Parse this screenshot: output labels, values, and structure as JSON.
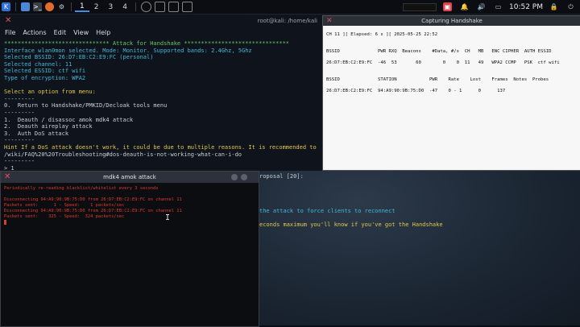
{
  "taskbar": {
    "workspaces": [
      "1",
      "2",
      "3",
      "4"
    ],
    "active_workspace": "1",
    "clock": "10:52 PM"
  },
  "main_terminal": {
    "title": "root@kali: /home/kali",
    "menu": [
      "File",
      "Actions",
      "Edit",
      "View",
      "Help"
    ],
    "lines": [
      {
        "text": "******************************* Attack for Handshake *******************************",
        "color": "c-green"
      },
      {
        "text": "Interface wlan0mon selected. Mode: Monitor. Supported bands: 2.4Ghz, 5Ghz",
        "color": "c-cyan"
      },
      {
        "text": "Selected BSSID: 26:D7:EB:C2:E9:FC (personal)",
        "color": "c-cyan"
      },
      {
        "text": "Selected channel: 11",
        "color": "c-cyan"
      },
      {
        "text": "Selected ESSID: ctf wifi",
        "color": "c-cyan"
      },
      {
        "text": "Type of encryption: WPA2",
        "color": "c-cyan"
      },
      {
        "text": "",
        "color": "c-grey"
      },
      {
        "text": "Select an option from menu:",
        "color": "c-yellow"
      },
      {
        "text": "---------",
        "color": "c-grey"
      },
      {
        "text": "0.  Return to Handshake/PMKID/Decloak tools menu",
        "color": "c-grey"
      },
      {
        "text": "---------",
        "color": "c-grey"
      },
      {
        "text": "1.  Deauth / disassoc amok mdk4 attack",
        "color": "c-grey"
      },
      {
        "text": "2.  Deauth aireplay attack",
        "color": "c-grey"
      },
      {
        "text": "3.  Auth DoS attack",
        "color": "c-grey"
      },
      {
        "text": "---------",
        "color": "c-grey"
      },
      {
        "text": "Hint If a DoS attack doesn't work, it could be due to multiple reasons. It is recommended to",
        "color": "c-yellow"
      },
      {
        "text": "/wiki/FAQ%20%20Troubleshooting#dos-deauth-is-not-working-what-can-i-do",
        "color": "c-grey"
      },
      {
        "text": "---------",
        "color": "c-grey"
      },
      {
        "text": "> 1",
        "color": "c-grey"
      }
    ],
    "lower_lines": [
      {
        "text": "roposal [20]:",
        "color": "c-grey",
        "row": 0
      },
      {
        "text": "the attack to force clients to reconnect",
        "color": "c-cyan",
        "row": 5
      },
      {
        "text": "econds maximum you'll know if you've got the Handshake",
        "color": "c-yellow",
        "row": 7
      }
    ]
  },
  "capture_window": {
    "title": "Capturing Handshake",
    "status": "CH 11 ][ Elapsed: 6 s ][ 2025-05-25 22:52",
    "ap_header": "BSSID              PWR RXQ  Beacons    #Data, #/s  CH   MB   ENC CIPHER  AUTH ESSID",
    "ap_row": "26:D7:EB:C2:E9:FC  -46  53       60        0    0  11   49   WPA2 CCMP   PSK  ctf wifi",
    "sta_header": "BSSID              STATION            PWR    Rate    Lost    Frames  Notes  Probes",
    "sta_row": "26:D7:EB:C2:E9:FC  94:A9:90:9B:75:D0  -47    0 - 1      0      137"
  },
  "mdk_window": {
    "title": "mdk4 amok attack",
    "lines": [
      "Periodically re-reading blacklist/whitelist every 3 seconds",
      "",
      "Disconnecting 94:A9:90:9B:75:D0 from 26:D7:EB:C2:E9:FC on channel 11",
      "Packets sent:      1 - Speed:    1 packets/sec",
      "Disconnecting 94:A9:90:9B:75:D0 from 26:D7:EB:C2:E9:FC on channel 11",
      "Packets sent:    325 - Speed:  324 packets/sec"
    ]
  }
}
